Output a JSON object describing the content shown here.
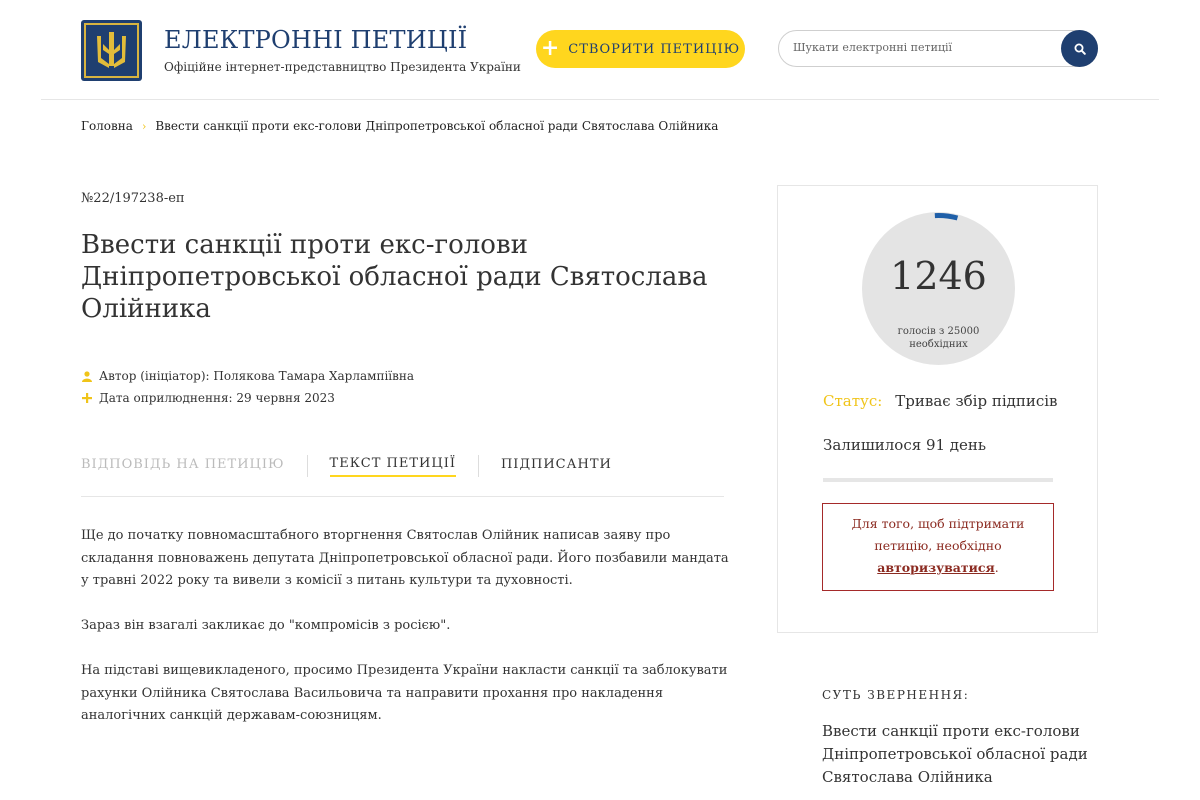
{
  "header": {
    "site_title": "ЕЛЕКТРОННІ ПЕТИЦІЇ",
    "site_subtitle": "Офіційне інтернет-представництво Президента України",
    "create_button_label": "СТВОРИТИ ПЕТИЦІЮ",
    "search_placeholder": "Шукати електронні петиції",
    "icons": [
      "coat-of-arms-logo",
      "plus-icon",
      "search-icon"
    ]
  },
  "breadcrumb": {
    "home": "Головна",
    "current": "Ввести санкції проти екс-голови Дніпропетровської обласної ради Святослава Олійника"
  },
  "petition": {
    "number": "№22/197238-еп",
    "title": "Ввести санкції проти екс-голови Дніпропетровської обласної ради Святослава Олійника",
    "author": "Автор (ініціатор): Полякова Тамара Харлампіївна",
    "date": "Дата оприлюднення: 29 червня 2023",
    "paragraphs": [
      "Ще до початку повномасштабного вторгнення Святослав Олійник написав заяву про складання повноважень депутата Дніпропетровської обласної ради. Його позбавили мандата у травні 2022 року та вивели з комісії з питань культури та духовності.",
      "Зараз він взагалі закликає до \"компромісів з росією\".",
      "На підставі вищевикладеного, просимо Президента України накласти санкції та заблокувати рахунки Олійника Святослава Васильовича та направити прохання про накладення аналогічних санкцій державам-союзницям."
    ]
  },
  "tabs": {
    "answer": "ВІДПОВІДЬ НА ПЕТИЦІЮ",
    "text": "ТЕКСТ ПЕТИЦІЇ",
    "signers": "ПІДПИСАНТИ",
    "active": "text"
  },
  "sidebar": {
    "votes_count": "1246",
    "votes_caption": "голосів з 25000 необхідних",
    "votes_progress": 0.0498,
    "status_label": "Статус:",
    "status_value": "Триває збір підписів",
    "days_left": "Залишилося 91 день",
    "auth_text": "Для того, щоб підтримати петицію, необхідно",
    "auth_link": "авторизуватися",
    "auth_suffix": ".",
    "essence_heading": "СУТЬ ЗВЕРНЕННЯ:",
    "essence_text": "Ввести санкції проти екс-голови Дніпропетровської обласної ради Святослава Олійника"
  },
  "colors": {
    "brand_navy": "#1f3f70",
    "accent_yellow": "#ffd61e",
    "progress_blue": "#1f5fa8",
    "auth_red": "#a52a2a"
  }
}
